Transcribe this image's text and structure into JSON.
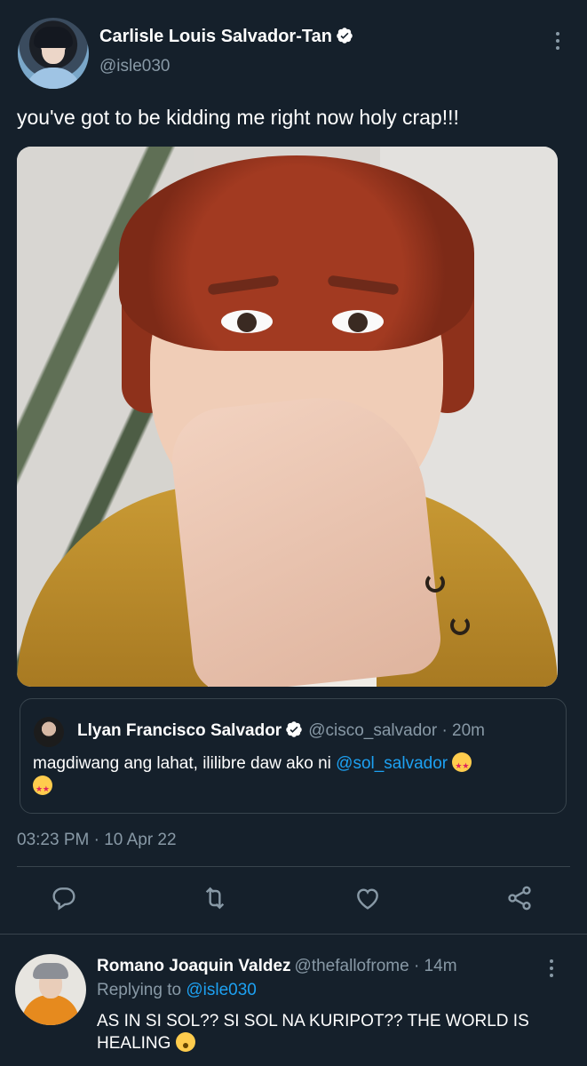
{
  "tweet": {
    "author_name": "Carlisle Louis Salvador-Tan",
    "author_handle": "@isle030",
    "verified": true,
    "text": "you've got to be kidding me right now holy crap!!!",
    "timestamp": "03:23 PM · 10 Apr 22",
    "icons": [
      "more-vertical-icon",
      "verified-badge-icon"
    ]
  },
  "quote": {
    "author_name": "Llyan Francisco Salvador",
    "author_handle": "@cisco_salvador · 20m",
    "text_before": "magdiwang ang lahat, ililibre daw ako ni ",
    "mention": "@sol_salvador",
    "emoji": "star-struck-emoji"
  },
  "actions": {
    "reply_icon": "reply-icon",
    "retweet_icon": "retweet-icon",
    "like_icon": "like-icon",
    "share_icon": "share-icon"
  },
  "reply": {
    "author_name": "Romano Joaquin Valdez",
    "author_handle": "@thefallofrome · 14m",
    "replying_label": "Replying to ",
    "replying_to": "@isle030",
    "text": "AS IN SI SOL?? SI SOL NA KURIPOT?? THE WORLD IS HEALING",
    "emoji": "flushed-emoji"
  },
  "colors": {
    "background": "#15202b",
    "secondary_text": "#8899a6",
    "accent": "#1da1f2",
    "divider": "#38444d"
  }
}
